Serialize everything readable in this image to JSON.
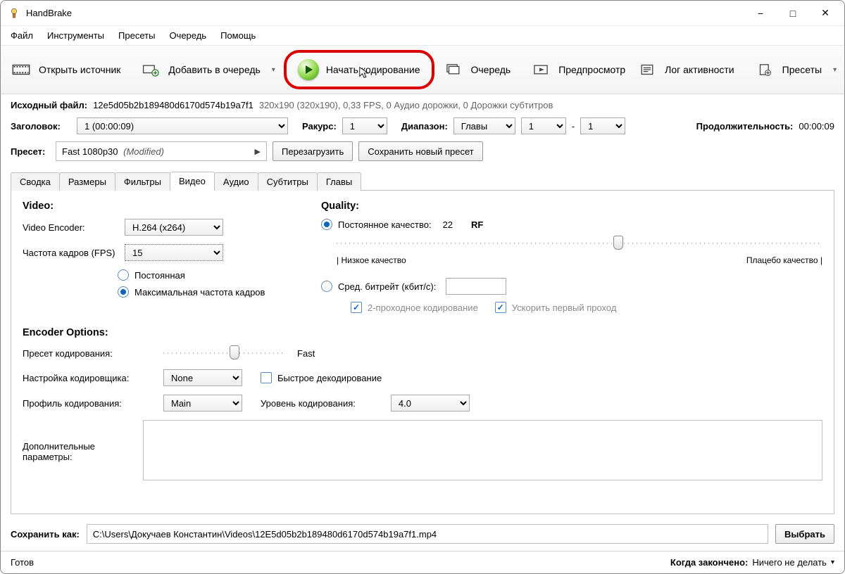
{
  "window": {
    "title": "HandBrake"
  },
  "menu": {
    "items": [
      "Файл",
      "Инструменты",
      "Пресеты",
      "Очередь",
      "Помощь"
    ]
  },
  "toolbar": {
    "open_source": "Открыть источник",
    "add_queue": "Добавить в очередь",
    "start_encode": "Начать кодирование",
    "queue": "Очередь",
    "preview": "Предпросмотр",
    "activity_log": "Лог активности",
    "presets": "Пресеты"
  },
  "source": {
    "label": "Исходный файл:",
    "name": "12e5d05b2b189480d6170d574b19a7f1",
    "info": "320x190 (320x190), 0,33 FPS, 0 Аудио дорожки, 0 Дорожки субтитров"
  },
  "title_row": {
    "label": "Заголовок:",
    "title_value": "1  (00:00:09)",
    "angle_label": "Ракурс:",
    "angle_value": "1",
    "range_label": "Диапазон:",
    "range_type": "Главы",
    "range_from": "1",
    "range_dash": "-",
    "range_to": "1",
    "duration_label": "Продолжительность:",
    "duration_value": "00:00:09"
  },
  "preset_row": {
    "label": "Пресет:",
    "value": "Fast 1080p30",
    "modified": "(Modified)",
    "reload": "Перезагрузить",
    "save_new": "Сохранить новый пресет"
  },
  "tabs": [
    "Сводка",
    "Размеры",
    "Фильтры",
    "Видео",
    "Аудио",
    "Субтитры",
    "Главы"
  ],
  "active_tab": "Видео",
  "video": {
    "heading": "Video:",
    "encoder_label": "Video Encoder:",
    "encoder_value": "H.264 (x264)",
    "fps_label": "Частота кадров (FPS)",
    "fps_value": "15",
    "fps_constant": "Постоянная",
    "fps_peak": "Максимальная частота кадров",
    "options_heading": "Encoder Options:",
    "enc_preset_label": "Пресет кодирования:",
    "enc_preset_value": "Fast",
    "enc_tune_label": "Настройка кодировщика:",
    "enc_tune_value": "None",
    "fast_decode": "Быстрое декодирование",
    "enc_profile_label": "Профиль кодирования:",
    "enc_profile_value": "Main",
    "enc_level_label": "Уровень кодирования:",
    "enc_level_value": "4.0",
    "addl_label": "Дополнительные параметры:"
  },
  "quality": {
    "heading": "Quality:",
    "cq_label": "Постоянное качество:",
    "cq_value": "22",
    "cq_unit": "RF",
    "low_label": "| Низкое качество",
    "placebo_label": "Плацебо качество |",
    "avg_label": "Сред. битрейт (кбит/с):",
    "two_pass": "2-проходное кодирование",
    "turbo_first": "Ускорить первый проход"
  },
  "save": {
    "label": "Сохранить как:",
    "path": "C:\\Users\\Докучаев Константин\\Videos\\12E5d05b2b189480d6170d574b19a7f1.mp4",
    "browse": "Выбрать"
  },
  "status": {
    "ready": "Готов",
    "when_done_label": "Когда закончено:",
    "when_done_value": "Ничего не делать"
  }
}
